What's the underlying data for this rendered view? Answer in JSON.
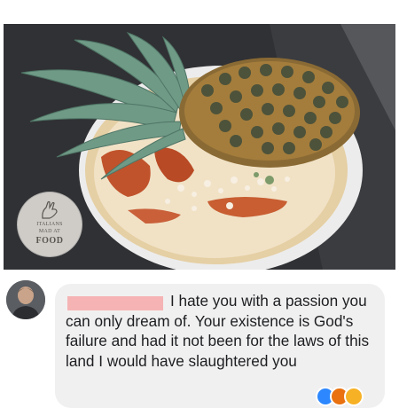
{
  "post": {
    "watermark": {
      "line1": "ITALIANS",
      "line2": "MAD AT",
      "line3": "FOOD"
    }
  },
  "comment": {
    "text": "I hate you with a passion you can only dream of. Your existence is God's failure and had it not been for the laws of this land I would have slaughtered you",
    "commenter_name": "",
    "reactions": [
      "like-icon",
      "angry-icon",
      "haha-icon"
    ]
  },
  "colors": {
    "bubble": "#f1f0f0",
    "redaction": "#f5b3b4",
    "text": "#1c1e21"
  }
}
